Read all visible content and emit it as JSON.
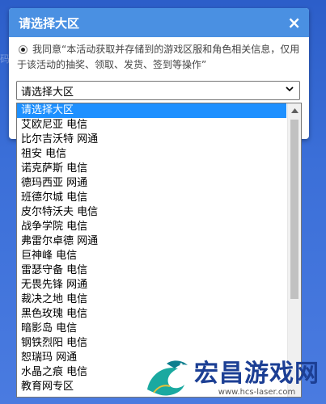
{
  "dialog": {
    "title": "请选择大区",
    "close_label": "×",
    "consent_text": "我同意“本活动获取并存储到的游戏区服和角色相关信息，仅用于该活动的抽奖、领取、发货、签到等操作”"
  },
  "select": {
    "value": "请选择大区"
  },
  "background": {
    "side_text": "码"
  },
  "dropdown": {
    "options": [
      "请选择大区",
      "艾欧尼亚 电信",
      "比尔吉沃特 网通",
      "祖安 电信",
      "诺克萨斯 电信",
      "德玛西亚 网通",
      "班德尔城 电信",
      "皮尔特沃夫 电信",
      "战争学院 电信",
      "弗雷尔卓德 网通",
      "巨神峰 电信",
      "雷瑟守备 电信",
      "无畏先锋 网通",
      "裁决之地 电信",
      "黑色玫瑰 电信",
      "暗影岛 电信",
      "钢铁烈阳 电信",
      "恕瑞玛 网通",
      "水晶之痕 电信",
      "教育网专区"
    ],
    "selected_index": 0
  },
  "watermark": {
    "title": "宏昌游戏网",
    "url": "www.hcs-laser.com"
  },
  "colors": {
    "header": "#4a90e2",
    "selected": "#1e90ff",
    "watermark_text": "#1c3f94"
  }
}
